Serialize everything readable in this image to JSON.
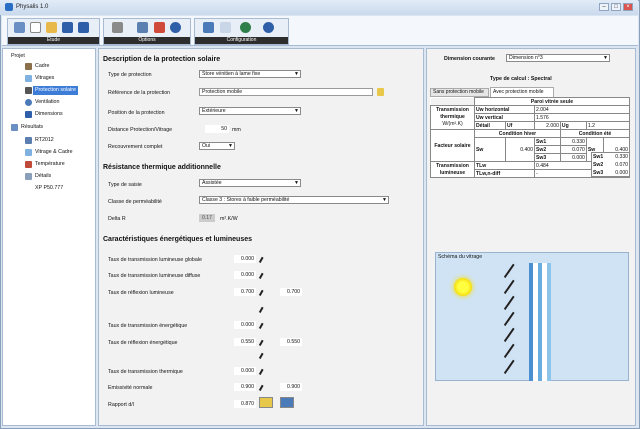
{
  "window": {
    "title": "Physalis 1.0"
  },
  "toolbar": {
    "groups": [
      "Etude",
      "Options",
      "Configuration"
    ]
  },
  "nav": {
    "projet": "Projet",
    "items": [
      "Cadre",
      "Vitrages",
      "Protection solaire",
      "Ventilation",
      "Dimensions"
    ],
    "resultats": "Résultats",
    "result_items": [
      "RT2012",
      "Vitrage & Cadre",
      "Température",
      "Détails",
      "XP P50.777"
    ]
  },
  "desc": {
    "title": "Description de la protection solaire",
    "type_label": "Type de protection",
    "type_value": "Store vénitien à lame fixe",
    "ref_label": "Référence de la protection",
    "ref_value": "Protection mobile",
    "pos_label": "Position de la protection",
    "pos_value": "Extérieure",
    "dist_label": "Distance Protection/Vitrage",
    "dist_value": "50",
    "dist_unit": "mm",
    "recouv_label": "Recouvrement complet",
    "recouv_value": "Oui"
  },
  "res": {
    "title": "Résistance thermique additionnelle",
    "saisie_label": "Type de saisie",
    "saisie_value": "Assistée",
    "perm_label": "Classe de perméabilité",
    "perm_value": "Classe 3 : Stores à faible perméabilité",
    "delta_label": "Delta R",
    "delta_value": "0.17",
    "delta_unit": "m².K/W"
  },
  "carac": {
    "title": "Caractéristiques énergétiques et lumineuses",
    "rows": [
      {
        "label": "Taux de transmission lumineuse globale",
        "v1": "0.000",
        "v2": ""
      },
      {
        "label": "Taux de transmission lumineuse diffuse",
        "v1": "0.000",
        "v2": ""
      },
      {
        "label": "Taux de réflexion lumineuse",
        "v1": "0.700",
        "v2": "0.700"
      },
      {
        "label": "Taux de transmission énergétique",
        "v1": "0.000",
        "v2": ""
      },
      {
        "label": "Taux de réflexion énergétique",
        "v1": "0.550",
        "v2": "0.550"
      },
      {
        "label": "Taux de transmission thermique",
        "v1": "0.000",
        "v2": ""
      },
      {
        "label": "Emissivité normale",
        "v1": "0.900",
        "v2": "0.900"
      },
      {
        "label": "Rapport d/l",
        "v1": "0.870",
        "v2": ""
      }
    ]
  },
  "right": {
    "dim_label": "Dimension courante",
    "dim_value": "Dimension n°3",
    "calc": "Type de calcul : Spectral",
    "tab1": "Sans protection mobile",
    "tab2": "Avec protection mobile",
    "table": {
      "header": "Paroi vitrée seule",
      "trans_therm": "Transmission thermique",
      "trans_unit": "W/(m².K)",
      "uw_h": "Uw horizontal",
      "uw_h_val": "2.004",
      "uw_v": "Uw vertical",
      "uw_v_val": "1.576",
      "detail": "Détail",
      "uf": "Uf",
      "uf_val": "2.000",
      "ug": "Ug",
      "ug_val": "1.2",
      "hiver": "Condition hiver",
      "ete": "Condition été",
      "facteur": "Facteur solaire",
      "sw": "Sw",
      "sw_h": "0.400",
      "sw_e": "0.400",
      "sw1": "Sw1",
      "sw2": "Sw2",
      "sw3": "Sw3",
      "sw1_h": "0.330",
      "sw2_h": "0.070",
      "sw3_h": "0.000",
      "sw1_e": "0.330",
      "sw2_e": "0.070",
      "sw3_e": "0.000",
      "trans_lum": "Transmission lumineuse",
      "tlw": "TLw",
      "tlw_val": "0.484",
      "tlwndiff": "TLw,n-diff",
      "tlwndiff_val": "-"
    },
    "schema_title": "Schéma du vitrage"
  }
}
